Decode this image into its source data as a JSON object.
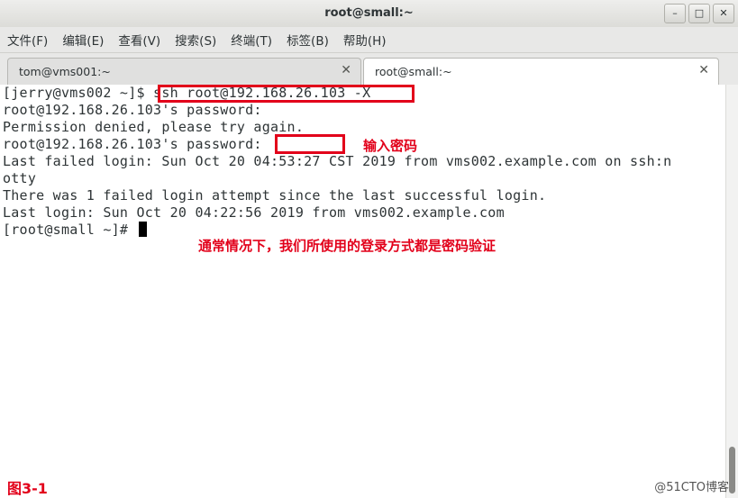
{
  "window": {
    "title": "root@small:~",
    "controls": [
      "–",
      "□",
      "✕"
    ]
  },
  "menu": [
    "文件(F)",
    "编辑(E)",
    "查看(V)",
    "搜索(S)",
    "终端(T)",
    "标签(B)",
    "帮助(H)"
  ],
  "tabs": [
    {
      "label": "tom@vms001:~",
      "active": false
    },
    {
      "label": "root@small:~",
      "active": true
    }
  ],
  "terminal": {
    "lines": [
      "[jerry@vms002 ~]$ ssh root@192.168.26.103 -X",
      "root@192.168.26.103's password:",
      "Permission denied, please try again.",
      "root@192.168.26.103's password:",
      "Last failed login: Sun Oct 20 04:53:27 CST 2019 from vms002.example.com on ssh:n",
      "otty",
      "There was 1 failed login attempt since the last successful login.",
      "Last login: Sun Oct 20 04:22:56 2019 from vms002.example.com",
      "[root@small ~]# "
    ]
  },
  "annotations": {
    "password_hint": "输入密码",
    "note": "通常情况下，我们所使用的登录方式都是密码验证",
    "figure_label": "图3-1",
    "watermark": "@51CTO博客"
  },
  "colors": {
    "annotation": "#e2001a",
    "terminal_bg": "#ffffff",
    "terminal_fg": "#2e3436"
  }
}
